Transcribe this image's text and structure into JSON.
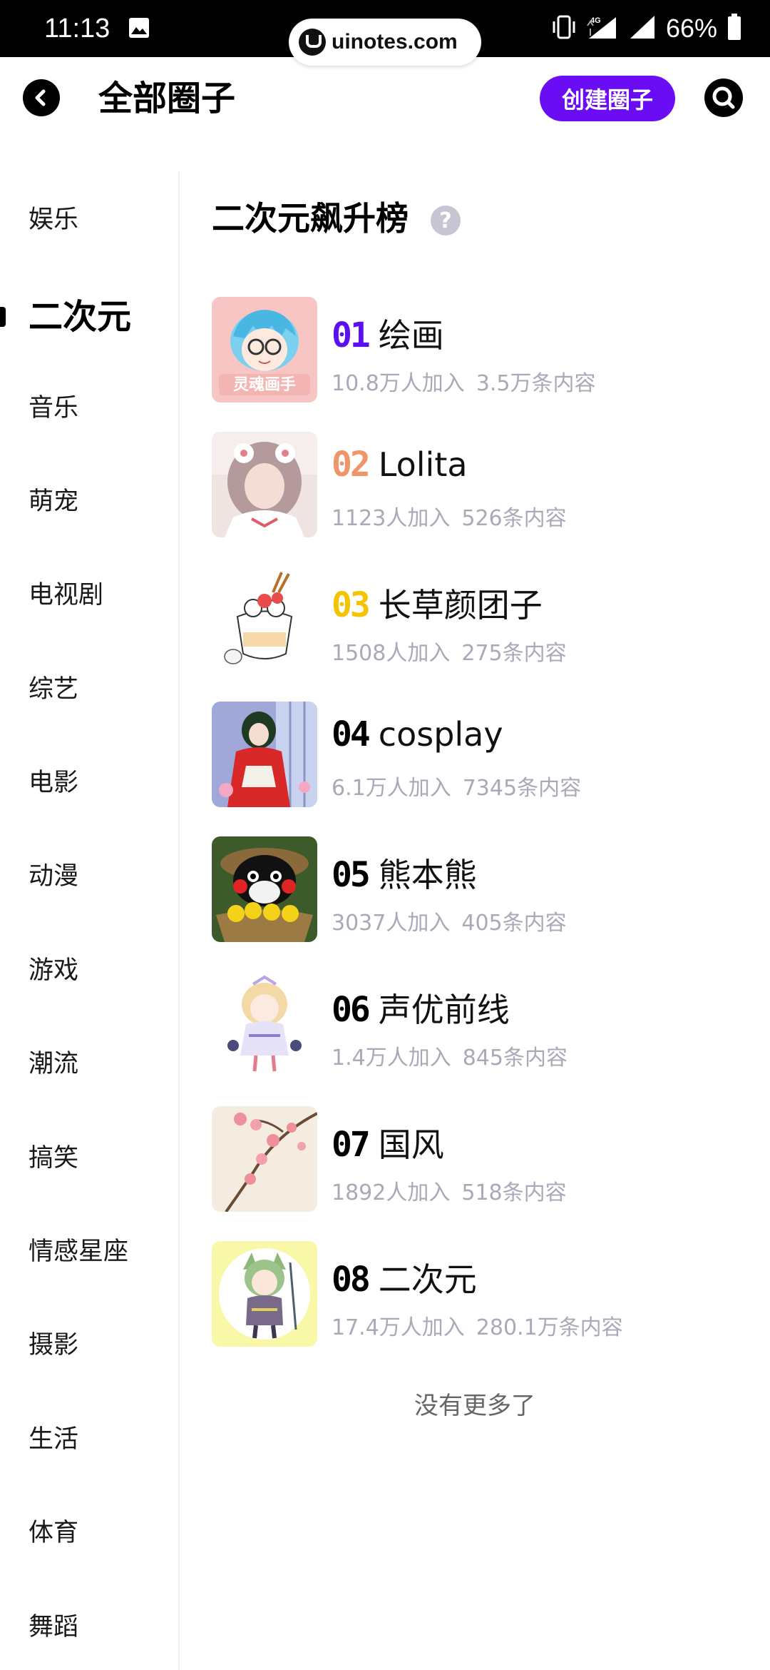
{
  "status_bar": {
    "time": "11:13",
    "battery": "66%",
    "network": "4G",
    "watermark": "uinotes.com"
  },
  "header": {
    "title": "全部圈子",
    "create_button": "创建圈子"
  },
  "sidebar": {
    "items": [
      {
        "label": "娱乐"
      },
      {
        "label": "二次元",
        "active": true
      },
      {
        "label": "音乐"
      },
      {
        "label": "萌宠"
      },
      {
        "label": "电视剧"
      },
      {
        "label": "综艺"
      },
      {
        "label": "电影"
      },
      {
        "label": "动漫"
      },
      {
        "label": "游戏"
      },
      {
        "label": "潮流"
      },
      {
        "label": "搞笑"
      },
      {
        "label": "情感星座"
      },
      {
        "label": "摄影"
      },
      {
        "label": "生活"
      },
      {
        "label": "体育"
      },
      {
        "label": "舞蹈"
      }
    ]
  },
  "main": {
    "section_title": "二次元飙升榜",
    "help_icon": "?",
    "circles": [
      {
        "rank": "01",
        "rank_color": "#5b10f0",
        "name": "绘画",
        "members": "10.8万人加入",
        "posts": "3.5万条内容",
        "thumb_label": "灵魂画手"
      },
      {
        "rank": "02",
        "rank_color": "#f0956a",
        "name": "Lolita",
        "members": "1123人加入",
        "posts": "526条内容"
      },
      {
        "rank": "03",
        "rank_color": "#f5c400",
        "name": "长草颜团子",
        "members": "1508人加入",
        "posts": "275条内容"
      },
      {
        "rank": "04",
        "rank_color": "#000000",
        "name": "cosplay",
        "members": "6.1万人加入",
        "posts": "7345条内容"
      },
      {
        "rank": "05",
        "rank_color": "#000000",
        "name": "熊本熊",
        "members": "3037人加入",
        "posts": "405条内容"
      },
      {
        "rank": "06",
        "rank_color": "#000000",
        "name": "声优前线",
        "members": "1.4万人加入",
        "posts": "845条内容"
      },
      {
        "rank": "07",
        "rank_color": "#000000",
        "name": "国风",
        "members": "1892人加入",
        "posts": "518条内容"
      },
      {
        "rank": "08",
        "rank_color": "#000000",
        "name": "二次元",
        "members": "17.4万人加入",
        "posts": "280.1万条内容"
      }
    ],
    "footer": "没有更多了"
  },
  "colors": {
    "accent": "#6a0df5",
    "muted_text": "#a9a9b8"
  },
  "icons": [
    "back-arrow-icon",
    "search-icon",
    "help-icon",
    "image-icon",
    "vibrate-icon",
    "signal-icon",
    "battery-icon"
  ]
}
